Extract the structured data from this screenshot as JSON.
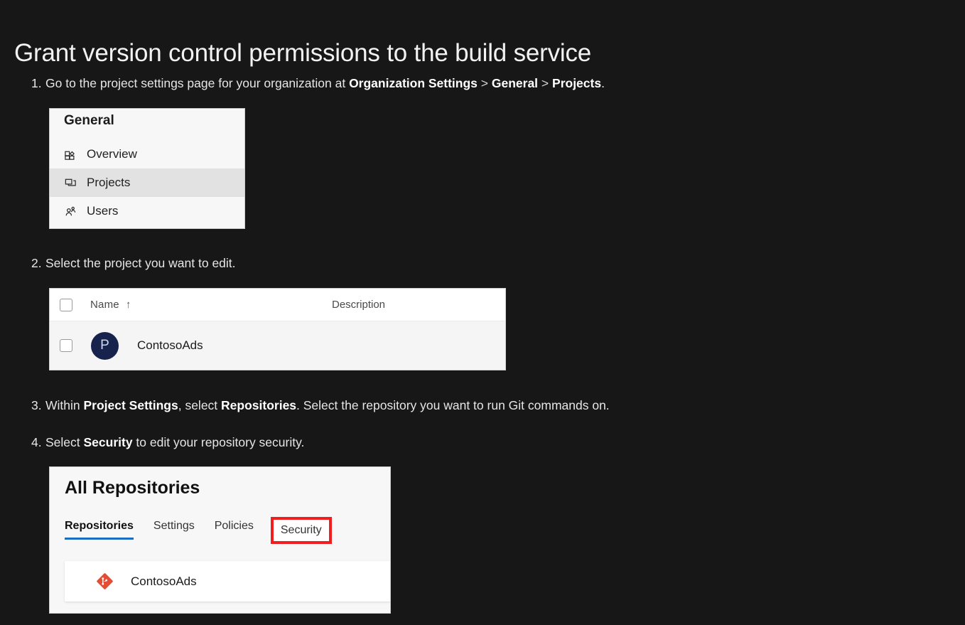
{
  "page": {
    "title": "Grant version control permissions to the build service",
    "background_color": "#171717",
    "text_color": "#e6e6e6"
  },
  "steps": [
    {
      "number": "1.",
      "parts": [
        {
          "text": "Go to the project settings page for your organization at ",
          "bold": false
        },
        {
          "text": "Organization Settings",
          "bold": true
        },
        {
          "text": " > ",
          "bold": false
        },
        {
          "text": "General",
          "bold": true
        },
        {
          "text": " > ",
          "bold": false
        },
        {
          "text": "Projects",
          "bold": true
        },
        {
          "text": ".",
          "bold": false
        }
      ],
      "plain": "1. Go to the project settings page for your organization at Organization Settings > General > Projects."
    },
    {
      "number": "2.",
      "plain": "2. Select the project you want to edit."
    },
    {
      "number": "3.",
      "plain": "3. Within Project Settings, select Repositories. Select the repository you want to run Git commands on."
    },
    {
      "number": "4.",
      "plain": "4. Select Security to edit your repository security."
    }
  ],
  "step1_text": {
    "lead": "Go to the project settings page for your organization at ",
    "crumb1": "Organization Settings",
    "sep1": " > ",
    "crumb2": "General",
    "sep2": " > ",
    "crumb3": "Projects",
    "period": "."
  },
  "step2_text": {
    "full": "Select the project you want to edit."
  },
  "step3_text": {
    "lead": "Within ",
    "bold1": "Project Settings",
    "mid": ", select ",
    "bold2": "Repositories",
    "tail": ". Select the repository you want to run Git commands on."
  },
  "step4_text": {
    "lead": "Select ",
    "bold1": "Security",
    "tail": " to edit your repository security."
  },
  "general_panel": {
    "heading": "General",
    "items": [
      {
        "label": "Overview",
        "icon": "dashboard-grid-icon",
        "selected": false
      },
      {
        "label": "Projects",
        "icon": "projects-stack-icon",
        "selected": true
      },
      {
        "label": "Users",
        "icon": "users-people-icon",
        "selected": false
      }
    ],
    "selected_row_color": "#e2e2e2"
  },
  "projects_table": {
    "columns": [
      {
        "label": "Name",
        "sort": "↑"
      },
      {
        "label": "Description",
        "sort": ""
      }
    ],
    "rows": [
      {
        "checkbox": false,
        "avatar_initial": "P",
        "avatar_color": "#17224d",
        "name": "ContosoAds",
        "description": ""
      }
    ]
  },
  "repos_panel": {
    "title": "All Repositories",
    "tabs": [
      {
        "label": "Repositories",
        "active": true,
        "highlighted": false
      },
      {
        "label": "Settings",
        "active": false,
        "highlighted": false
      },
      {
        "label": "Policies",
        "active": false,
        "highlighted": false
      },
      {
        "label": "Security",
        "active": false,
        "highlighted": true
      }
    ],
    "accent_color": "#1b6ec2",
    "highlight_color": "#f01e1e",
    "repositories": [
      {
        "name": "ContosoAds",
        "icon": "git-repo-icon",
        "icon_color": "#e44d33"
      }
    ]
  }
}
